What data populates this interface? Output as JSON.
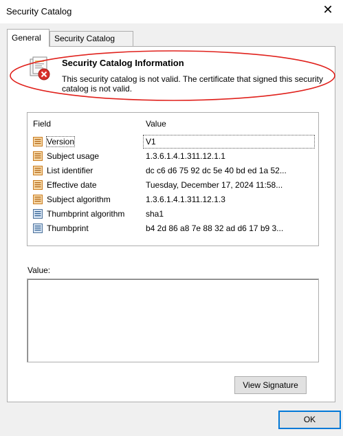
{
  "window": {
    "title": "Security Catalog",
    "close_glyph": "✕"
  },
  "tabs": [
    {
      "label": "General",
      "active": true
    },
    {
      "label": "Security Catalog",
      "active": false
    }
  ],
  "info": {
    "title": "Security Catalog Information",
    "message": "This security catalog is not valid. The certificate that signed this security catalog is not valid.",
    "icon": "certificate-error-icon",
    "highlight_color": "#e0201b"
  },
  "details": {
    "headers": {
      "field": "Field",
      "value": "Value"
    },
    "rows": [
      {
        "field": "Version",
        "value": "V1",
        "icon": "field-icon-orange"
      },
      {
        "field": "Subject usage",
        "value": "1.3.6.1.4.1.311.12.1.1",
        "icon": "field-icon-orange"
      },
      {
        "field": "List identifier",
        "value": "dc c6 d6 75 92 dc 5e 40 bd ed 1a 52...",
        "icon": "field-icon-orange"
      },
      {
        "field": "Effective date",
        "value": "Tuesday, December 17, 2024 11:58...",
        "icon": "field-icon-orange"
      },
      {
        "field": "Subject algorithm",
        "value": "1.3.6.1.4.1.311.12.1.3",
        "icon": "field-icon-orange"
      },
      {
        "field": "Thumbprint algorithm",
        "value": "sha1",
        "icon": "field-icon-blue"
      },
      {
        "field": "Thumbprint",
        "value": "b4 2d 86 a8 7e 88 32 ad d6 17 b9 3...",
        "icon": "field-icon-blue"
      }
    ]
  },
  "value_section": {
    "label": "Value:",
    "content": ""
  },
  "buttons": {
    "view_signature": "View Signature",
    "ok": "OK"
  },
  "colors": {
    "accent": "#0078d7",
    "error_red": "#e0201b"
  }
}
